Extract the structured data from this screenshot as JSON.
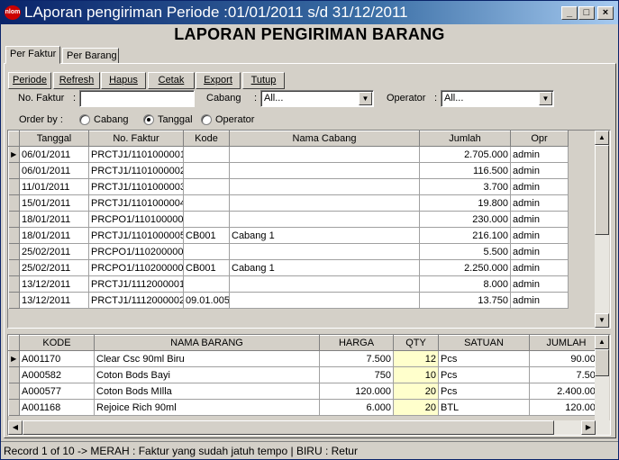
{
  "window": {
    "title": "LAporan pengiriman Periode :01/01/2011 s/d 31/12/2011",
    "icon_text": "nlom",
    "minimize_glyph": "_",
    "maximize_glyph": "□",
    "close_glyph": "×"
  },
  "heading": "LAPORAN PENGIRIMAN BARANG",
  "tabs": [
    "Per Faktur",
    "Per Barang"
  ],
  "toolbar": {
    "periode": "Periode",
    "refresh": "Refresh",
    "hapus": "Hapus",
    "cetak": "Cetak",
    "export": "Export",
    "tutup": "Tutup"
  },
  "filters": {
    "no_faktur_label": "No. Faktur",
    "colon": ":",
    "no_faktur_value": "",
    "cabang_label": "Cabang",
    "cabang_value": "All...",
    "operator_label": "Operator",
    "operator_value": "All..."
  },
  "order_by": {
    "label": "Order by :",
    "options": [
      "Cabang",
      "Tanggal",
      "Operator"
    ],
    "selected": "Tanggal"
  },
  "faktur_grid": {
    "columns": [
      "Tanggal",
      "No. Faktur",
      "Kode",
      "Nama Cabang",
      "Jumlah",
      "Opr"
    ],
    "rows": [
      [
        "06/01/2011",
        "PRCTJ1/1101000001",
        "",
        "",
        "2.705.000",
        "admin"
      ],
      [
        "06/01/2011",
        "PRCTJ1/1101000002",
        "",
        "",
        "116.500",
        "admin"
      ],
      [
        "11/01/2011",
        "PRCTJ1/1101000003",
        "",
        "",
        "3.700",
        "admin"
      ],
      [
        "15/01/2011",
        "PRCTJ1/1101000004",
        "",
        "",
        "19.800",
        "admin"
      ],
      [
        "18/01/2011",
        "PRCPO1/1101000001",
        "",
        "",
        "230.000",
        "admin"
      ],
      [
        "18/01/2011",
        "PRCTJ1/1101000005",
        "CB001",
        "Cabang 1",
        "216.100",
        "admin"
      ],
      [
        "25/02/2011",
        "PRCPO1/1102000001",
        "",
        "",
        "5.500",
        "admin"
      ],
      [
        "25/02/2011",
        "PRCPO1/1102000002",
        "CB001",
        "Cabang 1",
        "2.250.000",
        "admin"
      ],
      [
        "13/12/2011",
        "PRCTJ1/1112000001",
        "",
        "",
        "8.000",
        "admin"
      ],
      [
        "13/12/2011",
        "PRCTJ1/1112000002",
        "09.01.005",
        "",
        "13.750",
        "admin"
      ]
    ]
  },
  "barang_grid": {
    "columns": [
      "KODE",
      "NAMA BARANG",
      "HARGA",
      "QTY",
      "SATUAN",
      "JUMLAH"
    ],
    "rows": [
      [
        "A001170",
        "Clear Csc 90ml Biru",
        "7.500",
        "12",
        "Pcs",
        "90.000"
      ],
      [
        "A000582",
        "Coton Bods Bayi",
        "750",
        "10",
        "Pcs",
        "7.500"
      ],
      [
        "A000577",
        "Coton Bods MIlla",
        "120.000",
        "20",
        "Pcs",
        "2.400.000"
      ],
      [
        "A001168",
        "Rejoice Rich 90ml",
        "6.000",
        "20",
        "BTL",
        "120.000"
      ]
    ]
  },
  "current_row_marker": "▶",
  "scroll_arrows": {
    "up": "▲",
    "down": "▼",
    "left": "◀",
    "right": "▶"
  },
  "dropdown_arrow": "▼",
  "status": "Record 1 of 10 -> MERAH : Faktur yang sudah jatuh tempo | BIRU : Retur"
}
